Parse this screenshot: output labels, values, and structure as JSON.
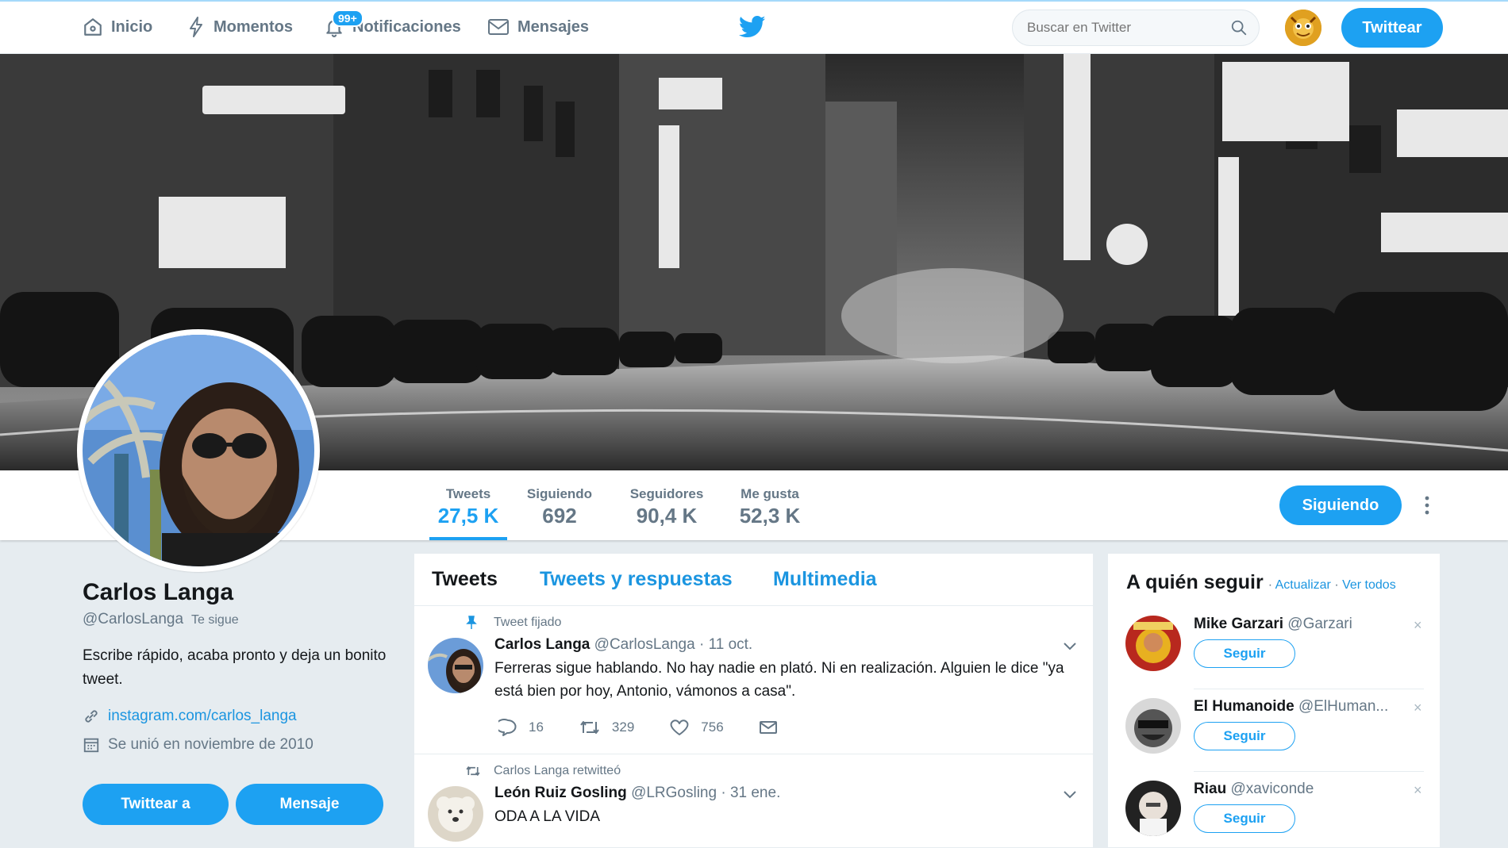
{
  "nav": {
    "items": [
      {
        "label": "Inicio",
        "icon": "home-icon"
      },
      {
        "label": "Momentos",
        "icon": "lightning-icon"
      },
      {
        "label": "Notificaciones",
        "icon": "bell-icon",
        "badge": "99+"
      },
      {
        "label": "Mensajes",
        "icon": "envelope-icon"
      }
    ],
    "search_placeholder": "Buscar en Twitter",
    "tweet_button": "Twittear",
    "accent": "#1da1f2"
  },
  "profile": {
    "name": "Carlos Langa",
    "handle": "@CarlosLanga",
    "follows_you": "Te sigue",
    "bio": "Escribe rápido, acaba pronto y deja un bonito tweet.",
    "link": "instagram.com/carlos_langa",
    "joined": "Se unió en noviembre de 2010",
    "tweet_to_button": "Twittear a",
    "message_button": "Mensaje"
  },
  "stats": [
    {
      "label": "Tweets",
      "value": "27,5 K"
    },
    {
      "label": "Siguiendo",
      "value": "692"
    },
    {
      "label": "Seguidores",
      "value": "90,4 K"
    },
    {
      "label": "Me gusta",
      "value": "52,3 K"
    }
  ],
  "following_button": "Siguiendo",
  "timeline": {
    "tabs": [
      "Tweets",
      "Tweets y respuestas",
      "Multimedia"
    ],
    "tweets": [
      {
        "context": "Tweet fijado",
        "name": "Carlos Langa",
        "handle": "@CarlosLanga",
        "date": "· 11 oct.",
        "text": "Ferreras sigue hablando. No hay nadie en plató. Ni en realización. Alguien le dice \"ya está bien por hoy, Antonio, vámonos a casa\".",
        "replies": "16",
        "retweets": "329",
        "likes": "756"
      },
      {
        "context": "Carlos Langa retwitteó",
        "name": "León Ruiz Gosling",
        "handle": "@LRGosling",
        "date": "· 31 ene.",
        "text": "ODA A LA VIDA"
      }
    ]
  },
  "who_to_follow": {
    "title": "A quién seguir",
    "refresh": "Actualizar",
    "separator": "·",
    "view_all": "Ver todos",
    "follow_label": "Seguir",
    "close_glyph": "×",
    "suggestions": [
      {
        "name": "Mike Garzari",
        "handle": "@Garzari"
      },
      {
        "name": "El Humanoide",
        "handle": "@ElHuman..."
      },
      {
        "name": "Riau",
        "handle": "@xaviconde"
      }
    ]
  }
}
